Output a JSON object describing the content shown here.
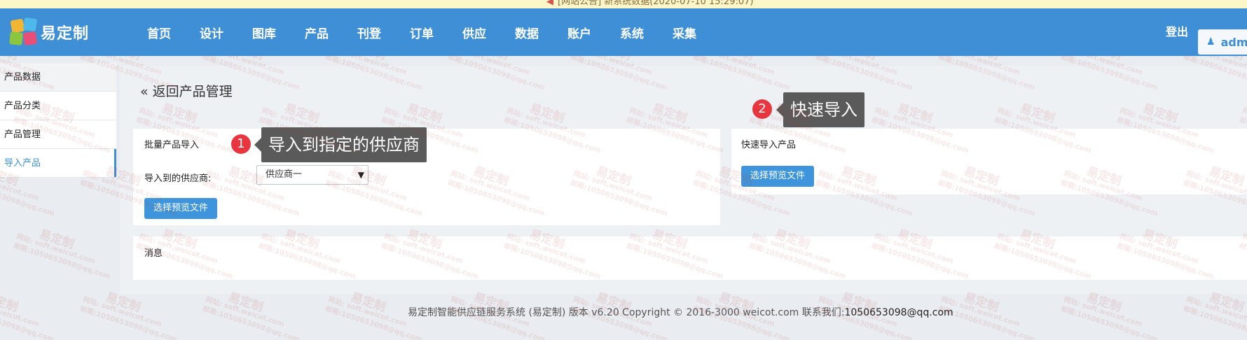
{
  "notice": {
    "text": "[网站公告] 新系统数据(2020-07-10 15:29:07)"
  },
  "header": {
    "logo_text": "易定制",
    "nav": [
      "首页",
      "设计",
      "图库",
      "产品",
      "刊登",
      "订单",
      "供应",
      "数据",
      "账户",
      "系统",
      "采集"
    ],
    "logout": "登出",
    "user": "admi"
  },
  "sidebar": {
    "items": [
      {
        "label": "产品数据"
      },
      {
        "label": "产品分类"
      },
      {
        "label": "产品管理"
      },
      {
        "label": "导入产品"
      }
    ]
  },
  "main": {
    "back_link": "« 返回产品管理",
    "batch_panel": {
      "title": "批量产品导入",
      "supplier_label": "导入到的供应商:",
      "supplier_selected": "供应商一",
      "choose_button": "选择预览文件"
    },
    "quick_panel": {
      "title": "快速导入产品",
      "choose_button": "选择预览文件"
    },
    "message_panel": {
      "title": "消息"
    }
  },
  "annotations": [
    {
      "number": "1",
      "text": "导入到指定的供应商"
    },
    {
      "number": "2",
      "text": "快速导入"
    }
  ],
  "watermark": {
    "title": "易定制",
    "site": "网站: soft.weicot.com",
    "email": "邮箱:1050653098@qq.com"
  },
  "footer": {
    "text": "易定制智能供应链服务系统 (易定制) 版本 v6.20 Copyright © 2016-3000 weicot.com 联系我们:",
    "email": "1050653098@qq.com"
  },
  "colors": {
    "nav_bg": "#3e8fd6",
    "button": "#3e95db",
    "badge": "#e8353f",
    "callout": "#5a5a5a"
  }
}
